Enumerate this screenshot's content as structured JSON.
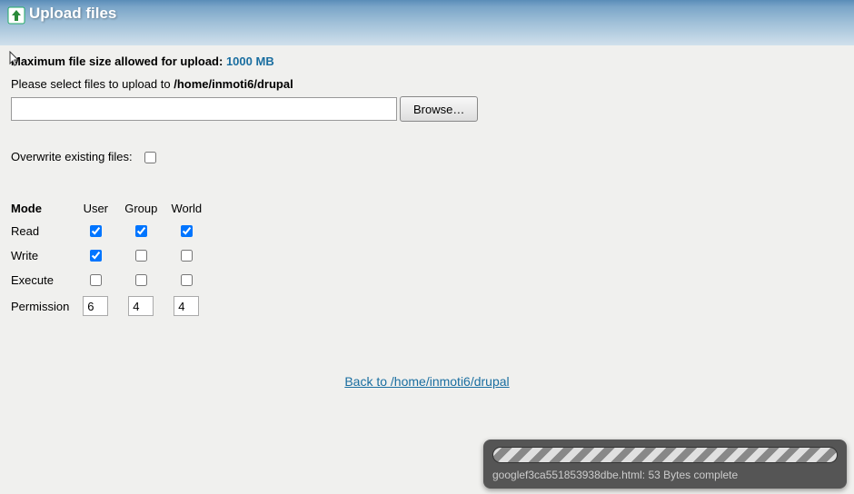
{
  "header": {
    "title": "Upload files"
  },
  "maxSize": {
    "label": "Maximum file size allowed for upload:",
    "value": "1000 MB"
  },
  "select": {
    "prefix": "Please select files to upload to ",
    "path": "/home/inmoti6/drupal"
  },
  "fileInput": {
    "value": ""
  },
  "browseLabel": "Browse…",
  "overwriteLabel": "Overwrite existing files:",
  "permsTable": {
    "modeHead": "Mode",
    "cols": [
      "User",
      "Group",
      "World"
    ],
    "rows": {
      "read": "Read",
      "write": "Write",
      "execute": "Execute",
      "permission": "Permission"
    },
    "perms": {
      "user": "6",
      "group": "4",
      "world": "4"
    }
  },
  "backLink": "Back to /home/inmoti6/drupal",
  "progress": {
    "text": "googlef3ca551853938dbe.html: 53 Bytes complete"
  }
}
